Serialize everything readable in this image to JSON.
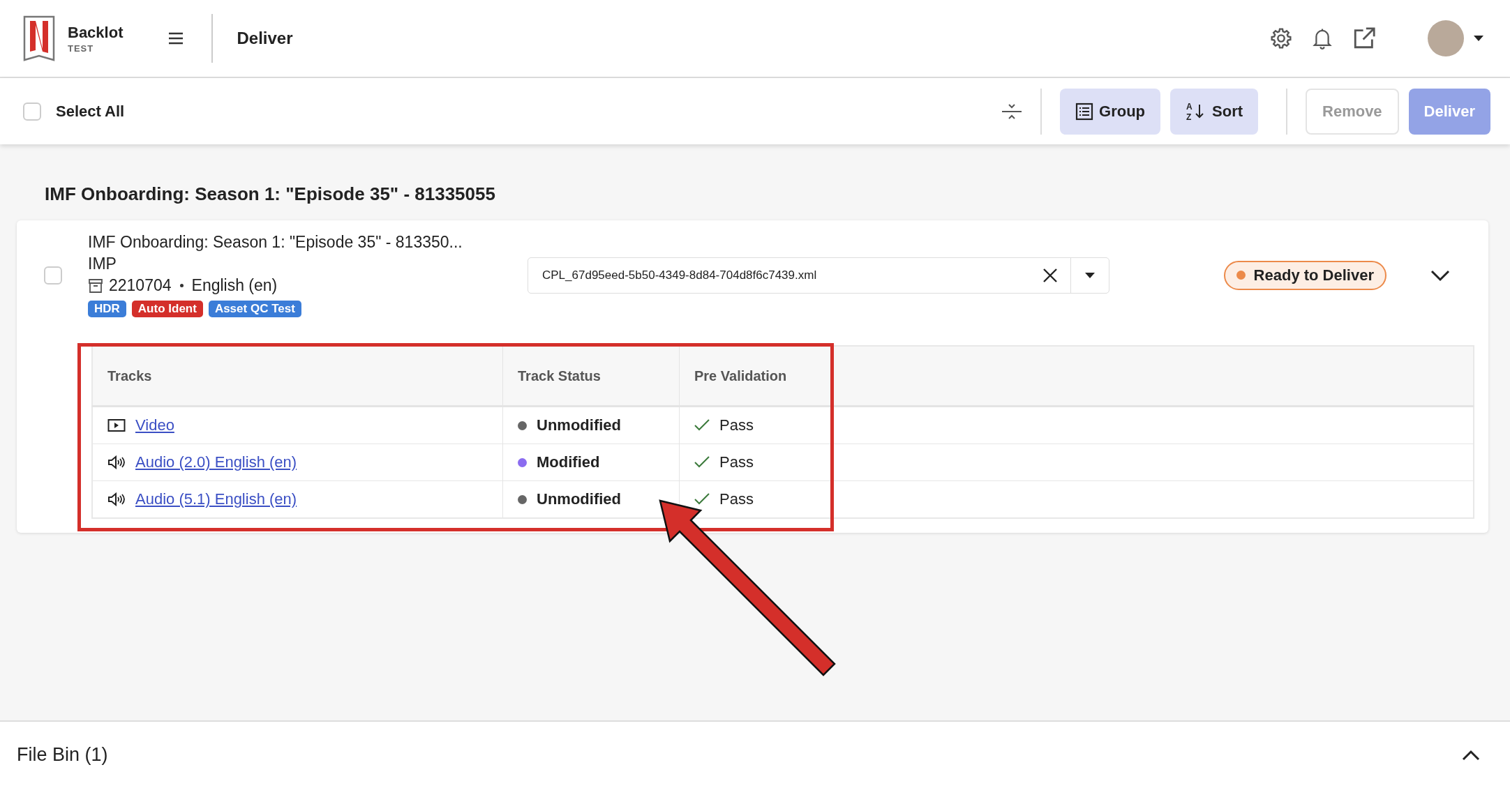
{
  "header": {
    "app_name": "Backlot",
    "environment": "TEST",
    "page_title": "Deliver"
  },
  "toolbar": {
    "select_all": {
      "label": "Select All",
      "checked": false
    },
    "buttons": [
      {
        "kind": "group",
        "label": "Group"
      },
      {
        "kind": "sort",
        "label": "Sort",
        "icon_letters": [
          "A",
          "Z"
        ]
      },
      {
        "kind": "outline",
        "label": "Remove",
        "disabled": true
      },
      {
        "kind": "primary",
        "label": "Deliver",
        "disabled": true
      }
    ]
  },
  "section": {
    "title": "IMF Onboarding: Season 1: \"Episode 35\" - 81335055",
    "item": {
      "checked": false,
      "title": "IMF Onboarding: Season 1: \"Episode 35\" - 813350...",
      "type": "IMP",
      "id": "2210704",
      "language": "English (en)",
      "tags": [
        {
          "label": "HDR",
          "color": "#3b7dd8"
        },
        {
          "label": "Auto Ident",
          "color": "#d42f2a"
        },
        {
          "label": "Asset QC Test",
          "color": "#3b7dd8"
        }
      ],
      "cpl_value": "CPL_67d95eed-5b50-4349-8d84-704d8f6c7439.xml",
      "status": {
        "label": "Ready to Deliver",
        "color": "#ec8a4a"
      },
      "expanded": true,
      "tracks": {
        "columns": [
          "Tracks",
          "Track Status",
          "Pre Validation"
        ],
        "rows": [
          {
            "kind": "video",
            "name": "Video",
            "status": "Unmodified",
            "color": "#666666",
            "validation": "Pass"
          },
          {
            "kind": "audio",
            "name": "Audio (2.0) English (en)",
            "status": "Modified",
            "color": "#8b6cf0",
            "validation": "Pass"
          },
          {
            "kind": "audio",
            "name": "Audio (5.1) English (en)",
            "status": "Unmodified",
            "color": "#666666",
            "validation": "Pass"
          }
        ]
      }
    }
  },
  "file_bin": {
    "title": "File Bin (1)",
    "expanded": false
  }
}
